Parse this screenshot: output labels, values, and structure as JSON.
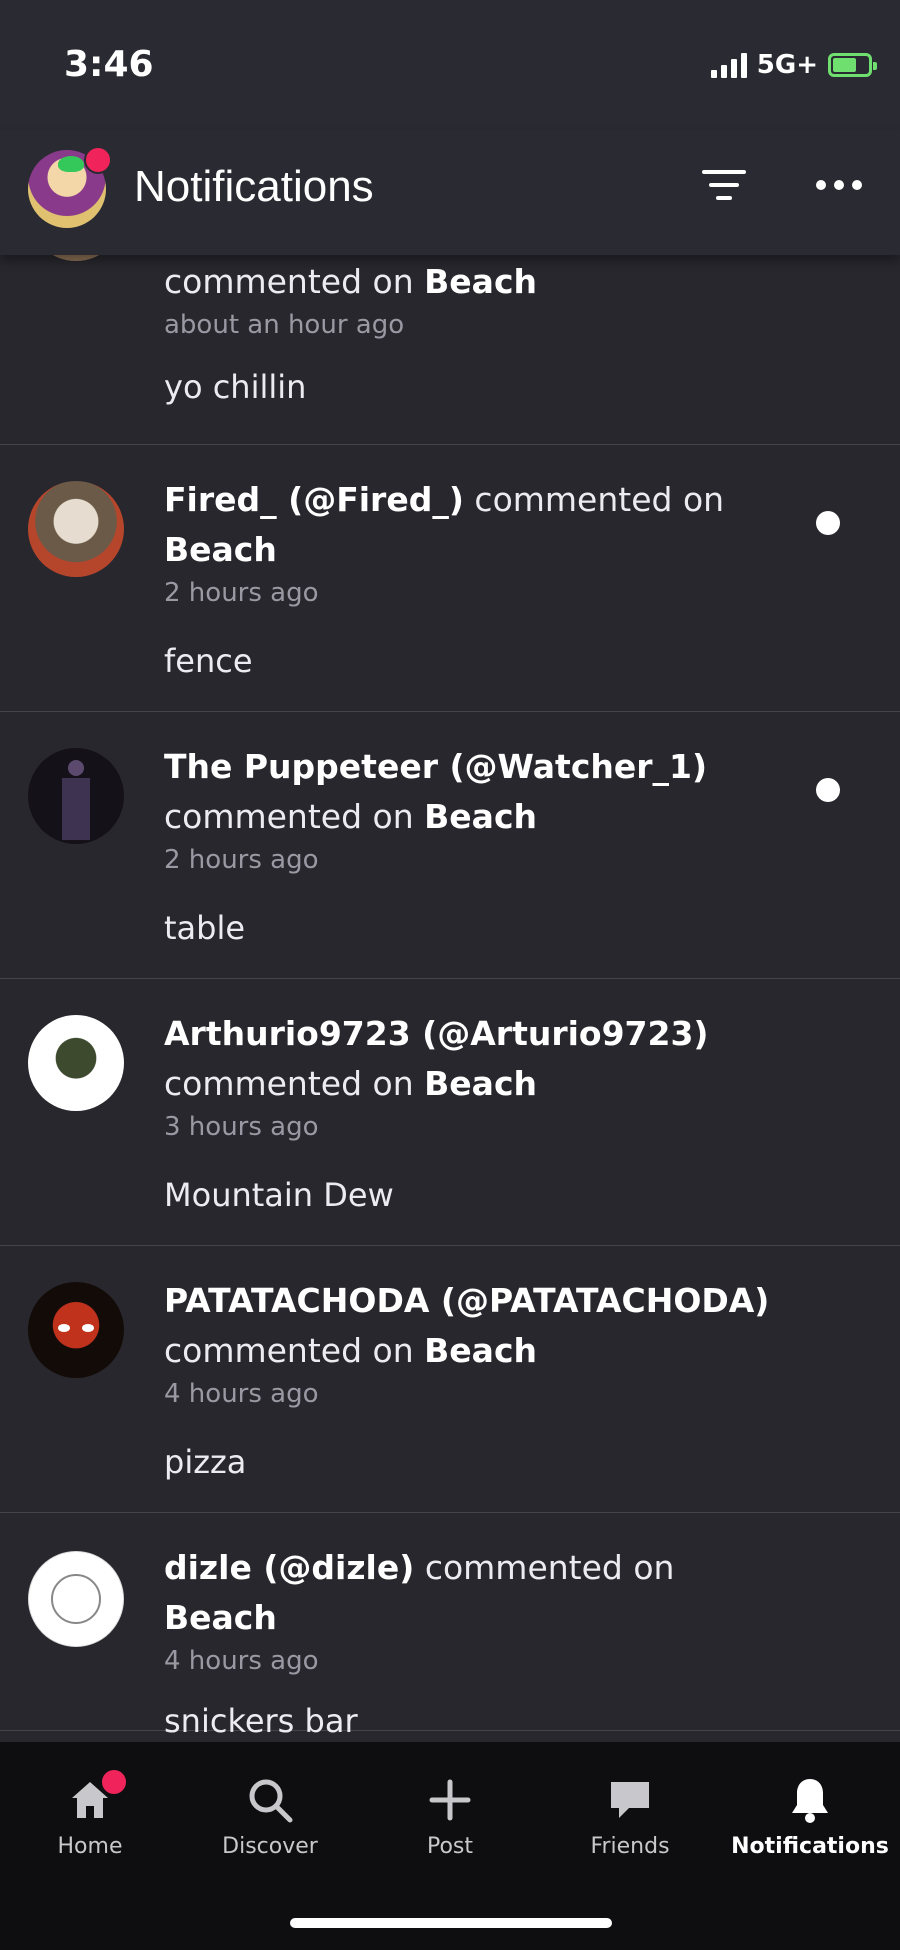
{
  "status": {
    "time": "3:46",
    "network": "5G+"
  },
  "header": {
    "title": "Notifications"
  },
  "notifications": [
    {
      "user": "",
      "action": "commented on",
      "post": "Beach",
      "time": "about an hour ago",
      "comment": "yo chillin",
      "unread": false
    },
    {
      "user": "Fired_ (@Fired_)",
      "action": "commented on",
      "post": "Beach",
      "time": "2 hours ago",
      "comment": "fence",
      "unread": true
    },
    {
      "user": "The Puppeteer (@Watcher_1)",
      "action": "commented on",
      "post": "Beach",
      "time": "2 hours ago",
      "comment": "table",
      "unread": true
    },
    {
      "user": "Arthurio9723 (@Arturio9723)",
      "action": "commented on",
      "post": "Beach",
      "time": "3 hours ago",
      "comment": "Mountain Dew",
      "unread": false
    },
    {
      "user": "PATATACHODA (@PATATACHODA)",
      "action": "commented on",
      "post": "Beach",
      "time": "4 hours ago",
      "comment": "pizza",
      "unread": false
    },
    {
      "user": "dizle (@dizle)",
      "action": "commented on",
      "post": "Beach",
      "time": "4 hours ago",
      "comment": "snickers bar",
      "unread": false
    }
  ],
  "nav": [
    {
      "label": "Home",
      "icon": "home-icon"
    },
    {
      "label": "Discover",
      "icon": "search-icon"
    },
    {
      "label": "Post",
      "icon": "plus-icon"
    },
    {
      "label": "Friends",
      "icon": "chat-bubble-icon"
    },
    {
      "label": "Notifications",
      "icon": "bell-icon",
      "active": true
    }
  ],
  "colors": {
    "accent": "#f0245a",
    "background": "#28272d",
    "battery": "#6fe06f"
  }
}
